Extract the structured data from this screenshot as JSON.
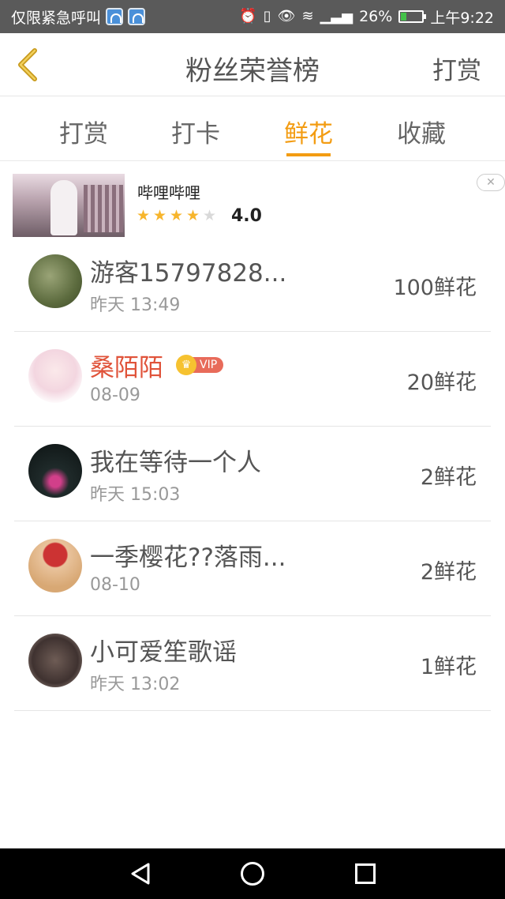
{
  "status": {
    "left_text": "仅限紧急呼叫",
    "battery": "26%",
    "time": "上午9:22",
    "battery_level": 0.26
  },
  "header": {
    "title": "粉丝荣誉榜",
    "action": "打赏"
  },
  "tabs": [
    {
      "label": "打赏"
    },
    {
      "label": "打卡"
    },
    {
      "label": "鲜花"
    },
    {
      "label": "收藏"
    }
  ],
  "ad": {
    "name": "哔哩哔哩",
    "rating": "4.0",
    "stars_filled": 4,
    "stars_total": 5
  },
  "list": [
    {
      "name": "游客15797828...",
      "date": "昨天 13:49",
      "amount": "100鲜花"
    },
    {
      "name": "桑陌陌",
      "date": "08-09",
      "amount": "20鲜花",
      "vip": "VIP"
    },
    {
      "name": "我在等待一个人",
      "date": "昨天 15:03",
      "amount": "2鲜花"
    },
    {
      "name": "一季樱花??落雨...",
      "date": "08-10",
      "amount": "2鲜花"
    },
    {
      "name": "小可爱笙歌谣",
      "date": "昨天 13:02",
      "amount": "1鲜花"
    }
  ],
  "colors": {
    "accent": "#f39c12",
    "vip_name": "#e0533a"
  }
}
